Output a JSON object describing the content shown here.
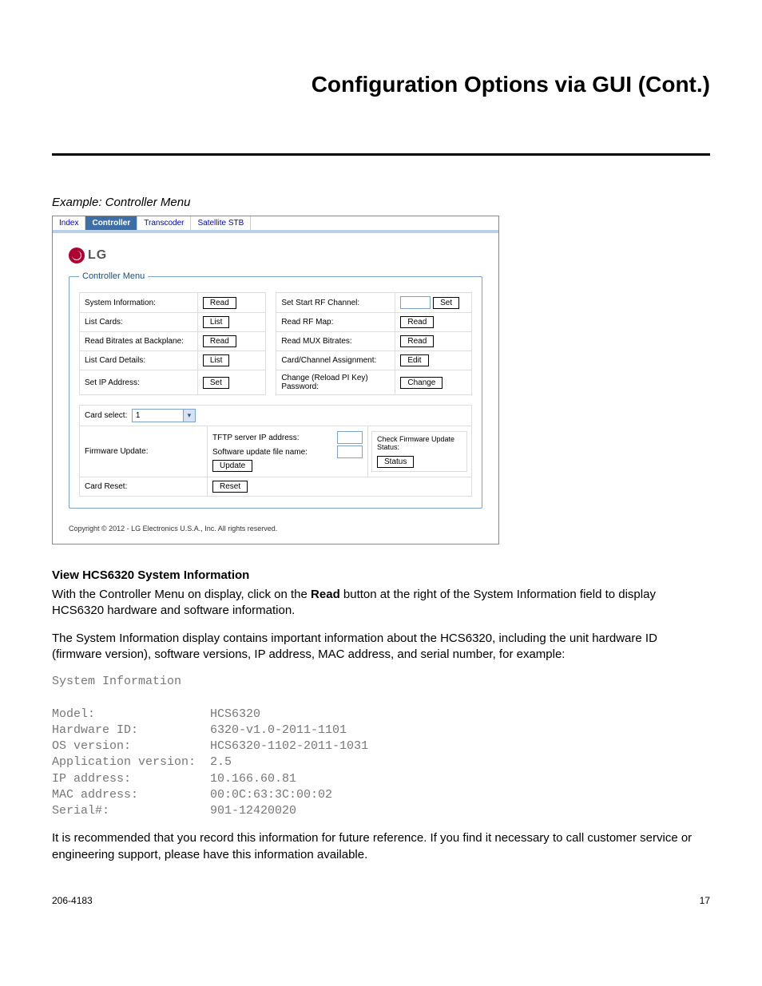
{
  "page_title": "Configuration Options via GUI (Cont.)",
  "caption": "Example: Controller Menu",
  "tabs": [
    "Index",
    "Controller",
    "Transcoder",
    "Satellite STB"
  ],
  "active_tab": "Controller",
  "logo_text": "LG",
  "fieldset_legend": "Controller Menu",
  "left_rows": [
    {
      "label": "System Information:",
      "button": "Read"
    },
    {
      "label": "List Cards:",
      "button": "List"
    },
    {
      "label": "Read Bitrates at Backplane:",
      "button": "Read"
    },
    {
      "label": "List Card Details:",
      "button": "List"
    },
    {
      "label": "Set IP Address:",
      "button": "Set"
    }
  ],
  "right_rows": [
    {
      "label": "Set Start RF Channel:",
      "button": "Set",
      "has_input": true
    },
    {
      "label": "Read RF Map:",
      "button": "Read",
      "has_input": false
    },
    {
      "label": "Read MUX Bitrates:",
      "button": "Read",
      "has_input": false
    },
    {
      "label": "Card/Channel Assignment:",
      "button": "Edit",
      "has_input": false
    },
    {
      "label": "Change (Reload PI Key) Password:",
      "button": "Change",
      "has_input": false
    }
  ],
  "card_select": {
    "label": "Card select:",
    "value": "1"
  },
  "firmware": {
    "label": "Firmware Update:",
    "tftp_label": "TFTP server IP address:",
    "swfile_label": "Software update file name:",
    "update_btn": "Update",
    "status_title": "Check Firmware Update Status:",
    "status_btn": "Status"
  },
  "card_reset": {
    "label": "Card Reset:",
    "button": "Reset"
  },
  "screenshot_copyright": "Copyright © 2012 - LG Electronics U.S.A., Inc. All rights reserved.",
  "section_heading": "View HCS6320 System Information",
  "para1_a": "With the Controller Menu on display, click on the ",
  "para1_bold": "Read",
  "para1_b": " button at the right of the System Information field to display HCS6320 hardware and software information.",
  "para2": "The System Information display contains important information about the HCS6320, including the unit hardware ID (firmware version), software versions, IP address, MAC address, and serial number, for example:",
  "sysinfo_header": "System Information",
  "sysinfo": {
    "Model:": "HCS6320",
    "Hardware ID:": "6320-v1.0-2011-1101",
    "OS version:": "HCS6320-1102-2011-1031",
    "Application version:": "2.5",
    "IP address:": "10.166.60.81",
    "MAC address:": "00:0C:63:3C:00:02",
    "Serial#:": "901-12420020"
  },
  "para3": "It is recommended that you record this information for future reference. If you find it necessary to call customer service or engineering support, please have this information available.",
  "footer_left": "206-4183",
  "footer_right": "17"
}
